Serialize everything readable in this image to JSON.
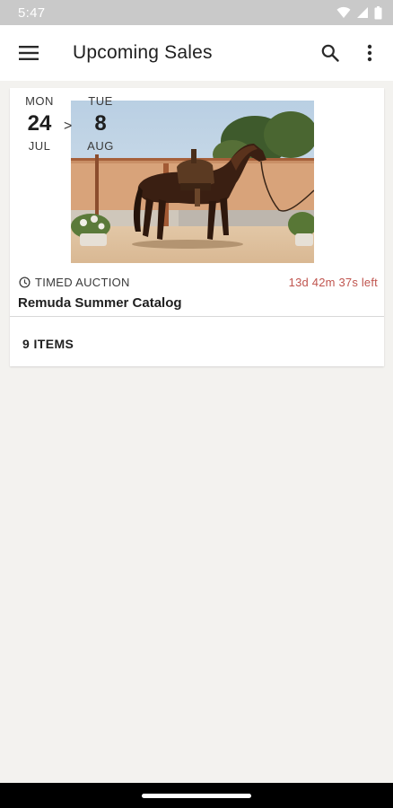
{
  "status_bar": {
    "time": "5:47"
  },
  "app_bar": {
    "title": "Upcoming Sales"
  },
  "sale": {
    "start": {
      "weekday": "MON",
      "day": "24",
      "month": "JUL"
    },
    "separator": ">",
    "end": {
      "weekday": "TUE",
      "day": "8",
      "month": "AUG"
    },
    "auction_type": "TIMED AUCTION",
    "time_left": "13d 42m 37s left",
    "name": "Remuda Summer Catalog",
    "items": "9 ITEMS"
  },
  "colors": {
    "countdown": "#c0554f",
    "background": "#f3f2ef",
    "status_bar": "#c9c9c9"
  },
  "icons": {
    "status": [
      "wifi-icon",
      "cell-signal-icon",
      "battery-icon"
    ],
    "app_bar": [
      "menu-icon",
      "search-icon",
      "more-vert-icon"
    ],
    "auction": "clock-icon"
  }
}
